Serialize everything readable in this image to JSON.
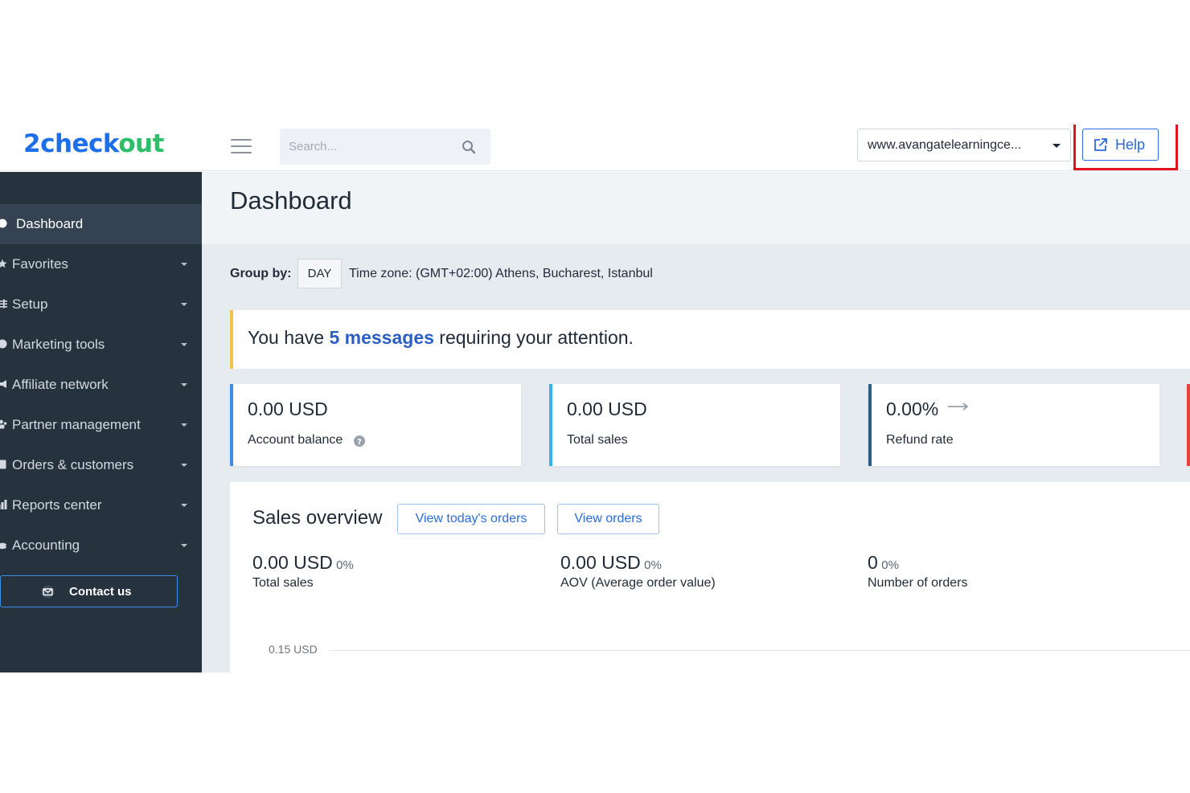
{
  "header": {
    "logo_part1": "2check",
    "logo_part2": "out",
    "search_placeholder": "Search...",
    "site_selector": "www.avangatelearningce...",
    "help_label": "Help"
  },
  "sidebar": {
    "items": [
      {
        "label": "Dashboard",
        "icon": "dashboard-icon",
        "active": true
      },
      {
        "label": "Favorites",
        "icon": "star-icon"
      },
      {
        "label": "Setup",
        "icon": "sliders-icon"
      },
      {
        "label": "Marketing tools",
        "icon": "pie-icon"
      },
      {
        "label": "Affiliate network",
        "icon": "megaphone-icon"
      },
      {
        "label": "Partner management",
        "icon": "users-icon"
      },
      {
        "label": "Orders & customers",
        "icon": "document-icon"
      },
      {
        "label": "Reports center",
        "icon": "chart-icon"
      },
      {
        "label": "Accounting",
        "icon": "coins-icon"
      }
    ],
    "contact_label": "Contact us"
  },
  "main": {
    "page_title": "Dashboard",
    "group_by_label": "Group by:",
    "group_by_value": "DAY",
    "timezone": "Time zone: (GMT+02:00) Athens, Bucharest, Istanbul",
    "alert": {
      "prefix": "You have ",
      "link": "5 messages",
      "suffix": " requiring your attention."
    },
    "cards": [
      {
        "value": "0.00 USD",
        "label": "Account balance",
        "accent": "#3c8fe6"
      },
      {
        "value": "0.00 USD",
        "label": "Total sales",
        "accent": "#35b4e8"
      },
      {
        "value": "0.00%",
        "label": "Refund rate",
        "accent": "#2c5f87"
      }
    ],
    "overview": {
      "title": "Sales overview",
      "btn_today": "View today's orders",
      "btn_orders": "View orders",
      "metrics": [
        {
          "value": "0.00 USD",
          "pct": "0%",
          "label": "Total sales"
        },
        {
          "value": "0.00 USD",
          "pct": "0%",
          "label": "AOV (Average order value)"
        },
        {
          "value": "0",
          "pct": "0%",
          "label": "Number of orders"
        }
      ],
      "chart_tick": "0.15 USD"
    }
  }
}
